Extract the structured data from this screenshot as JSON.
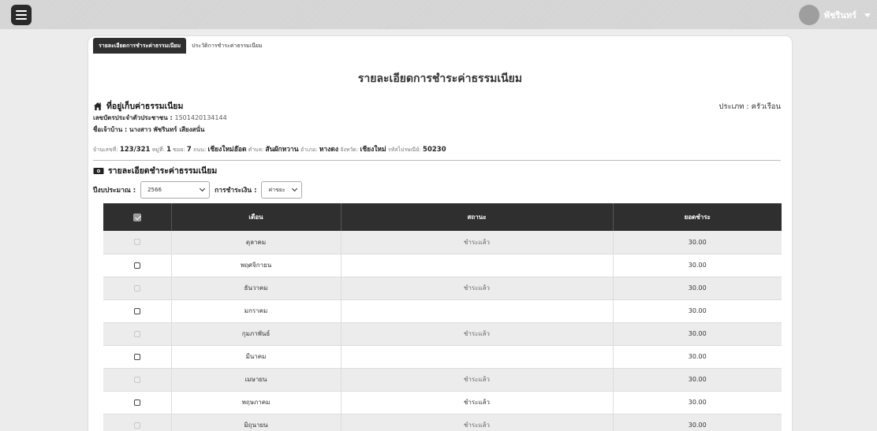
{
  "header": {
    "user_name": "พัชรินทร์"
  },
  "tabs": [
    {
      "label": "รายละเอียดการชำระค่าธรรมเนียม",
      "active": true
    },
    {
      "label": "ประวัติการชำระค่าธรรมเนียม",
      "active": false
    }
  ],
  "page_title": "รายละเอียดการชำระค่าธรรมเนียม",
  "address_section": {
    "title": "ที่อยู่เก็บค่าธรรมเนียม",
    "id_label": "เลขบัตรประจำตัวประชาชน :",
    "id_value": "1501420134144",
    "owner_label": "ชื่อเจ้าบ้าน :",
    "owner_value": "นางสาว พัชรินทร์ เสียงสนั่น",
    "type_text": "ประเภท : ครัวเรือน",
    "house_no_label": "บ้านเลขที่:",
    "house_no": "123/321",
    "moo_label": "หมู่ที่:",
    "moo": "1",
    "soi_label": "ซอย:",
    "soi": "7",
    "road_label": "ถนน:",
    "road": "เชียงใหม่ฮ๊อด",
    "subdistrict_label": "ตำบล:",
    "subdistrict": "สันผักหวาน",
    "district_label": "อำเภอ:",
    "district": "หางดง",
    "province_label": "จังหวัด:",
    "province": "เชียงใหม่",
    "postcode_label": "รหัสไปรษณีย์:",
    "postcode": "50230"
  },
  "payment_section": {
    "title": "รายละเอียดชำระค่าธรรมเนียม",
    "year_label": "ปีงบประมาณ :",
    "year_value": "2566",
    "payment_label": "การชำระเงิน :",
    "payment_value": "ค่าขยะ"
  },
  "table": {
    "columns": [
      "เดือน",
      "สถานะ",
      "ยอดชำระ"
    ],
    "rows": [
      {
        "month": "ตุลาคม",
        "status": "ชำระแล้ว",
        "amount": "30.00"
      },
      {
        "month": "พฤศจิกายน",
        "status": "",
        "amount": "30.00"
      },
      {
        "month": "ธันวาคม",
        "status": "ชำระแล้ว",
        "amount": "30.00"
      },
      {
        "month": "มกราคม",
        "status": "",
        "amount": "30.00"
      },
      {
        "month": "กุมภาพันธ์",
        "status": "ชำระแล้ว",
        "amount": "30.00"
      },
      {
        "month": "มีนาคม",
        "status": "",
        "amount": "30.00"
      },
      {
        "month": "เมษายน",
        "status": "ชำระแล้ว",
        "amount": "30.00"
      },
      {
        "month": "พฤษภาคม",
        "status": "ชำระแล้ว",
        "amount": "30.00"
      },
      {
        "month": "มิถุนายน",
        "status": "ชำระแล้ว",
        "amount": "30.00"
      }
    ]
  }
}
